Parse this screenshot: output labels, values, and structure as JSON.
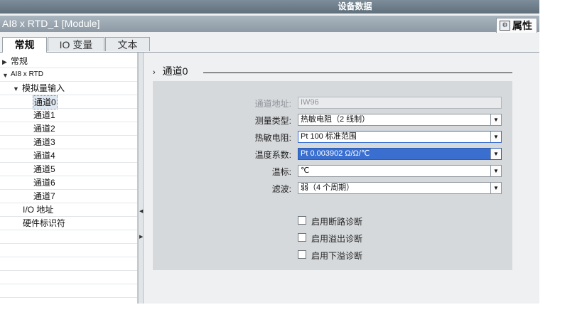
{
  "window": {
    "title": "设备数据",
    "module_title": "AI8 x RTD_1 [Module]",
    "properties_label": "属性"
  },
  "tabs": [
    {
      "label": "常规",
      "active": true
    },
    {
      "label": "IO 变量",
      "active": false
    },
    {
      "label": "文本",
      "active": false
    }
  ],
  "nav": {
    "items": [
      {
        "label": "常规",
        "level": 0,
        "arrow": "right"
      },
      {
        "label": "AI8 x RTD",
        "level": 0,
        "arrow": "down"
      },
      {
        "label": "模拟量输入",
        "level": 1,
        "arrow": "down"
      },
      {
        "label": "通道0",
        "level": 2,
        "selected": true
      },
      {
        "label": "通道1",
        "level": 2
      },
      {
        "label": "通道2",
        "level": 2
      },
      {
        "label": "通道3",
        "level": 2
      },
      {
        "label": "通道4",
        "level": 2
      },
      {
        "label": "通道5",
        "level": 2
      },
      {
        "label": "通道6",
        "level": 2
      },
      {
        "label": "通道7",
        "level": 2
      },
      {
        "label": "I/O 地址",
        "level": 1
      },
      {
        "label": "硬件标识符",
        "level": 1
      }
    ]
  },
  "section": {
    "title": "通道0"
  },
  "form": {
    "channel_address": {
      "label": "通道地址:",
      "value": "IW96"
    },
    "measure_type": {
      "label": "测量类型:",
      "value": "热敏电阻（2 线制）"
    },
    "thermistor": {
      "label": "热敏电阻:",
      "value": "Pt 100 标准范围"
    },
    "temp_coeff": {
      "label": "温度系数:",
      "value": "Pt 0.003902 Ω/Ω/℃"
    },
    "temp_scale": {
      "label": "温标:",
      "value": "℃"
    },
    "filter": {
      "label": "滤波:",
      "value": "弱（4 个周期）"
    }
  },
  "diagnostics": [
    {
      "label": "启用断路诊断",
      "checked": false
    },
    {
      "label": "启用溢出诊断",
      "checked": false
    },
    {
      "label": "启用下溢诊断",
      "checked": false
    }
  ],
  "colors": {
    "selection_blue": "#3a6fd0",
    "panel_gray": "#d6d9dc"
  }
}
